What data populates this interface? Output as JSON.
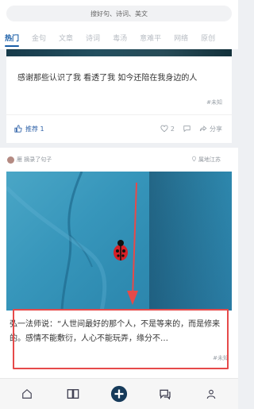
{
  "search": {
    "placeholder": "搜好句、诗词、美文"
  },
  "tabs": [
    {
      "label": "热门",
      "active": true
    },
    {
      "label": "金句"
    },
    {
      "label": "文章"
    },
    {
      "label": "诗词"
    },
    {
      "label": "毒汤"
    },
    {
      "label": "意难平"
    },
    {
      "label": "网络"
    },
    {
      "label": "原创"
    }
  ],
  "feed": {
    "card1": {
      "text": "感谢那些认识了我 看透了我 如今还陪在我身边的人",
      "source": "#未知",
      "recommend_label": "推荐 1",
      "like_count": "2",
      "share_label": "分享"
    },
    "card2": {
      "header": {
        "user_action": "雁 摘录了句子",
        "location": "属地江苏"
      },
      "text": "弘一法师说：“人世间最好的那个人，不是等来的，而是修来的。感情不能敷衍，人心不能玩弄，缘分不…",
      "source": "#未知"
    }
  },
  "colors": {
    "accent": "#1a5ea8",
    "highlight": "#e64a4a"
  },
  "icons": {
    "bottom_nav": [
      "home-icon",
      "book-icon",
      "add-icon",
      "message-icon",
      "profile-icon"
    ]
  }
}
